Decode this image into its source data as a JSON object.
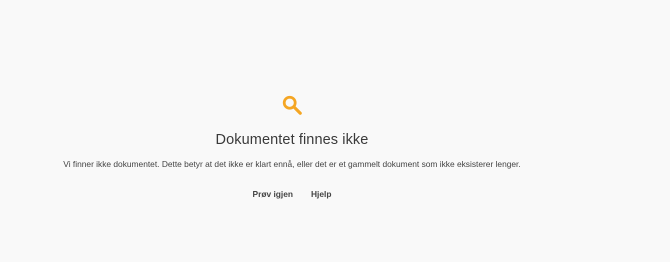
{
  "icon": {
    "name": "search-icon",
    "color": "#f5a623"
  },
  "heading": "Dokumentet finnes ikke",
  "description": "Vi finner ikke dokumentet. Dette betyr at det ikke er klart ennå, eller det er et gammelt dokument som ikke eksisterer lenger.",
  "actions": {
    "retry_label": "Prøv igjen",
    "help_label": "Hjelp"
  }
}
